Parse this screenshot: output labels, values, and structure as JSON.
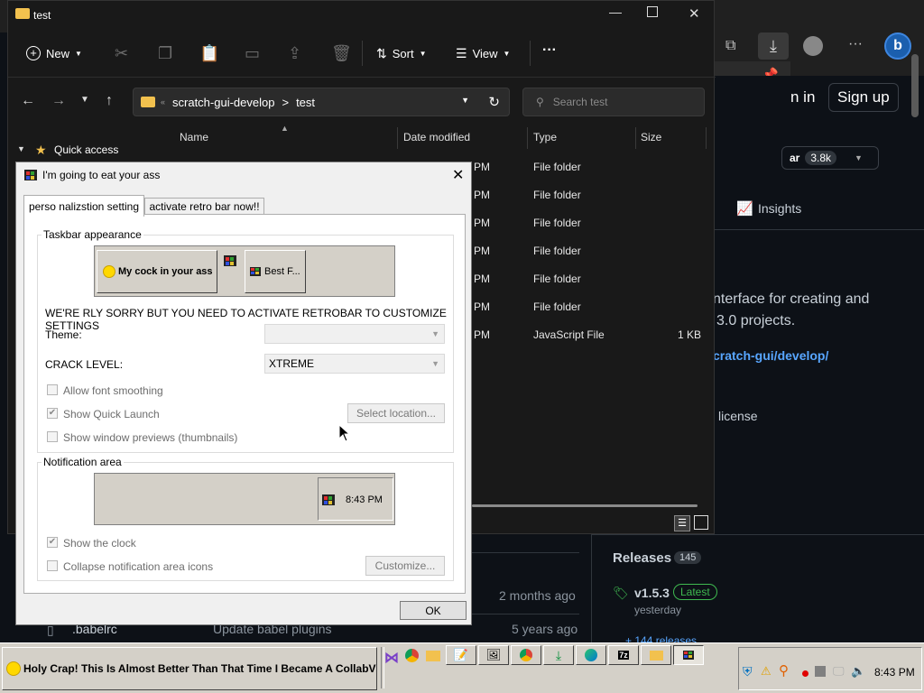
{
  "github": {
    "sign_in": "n in",
    "sign_up": "Sign up",
    "star_label": "ar",
    "star_count": "3.8k",
    "insights": "Insights",
    "description_1": "nterface for creating and",
    "description_2": "3.0 projects.",
    "link": "cratch-gui/develop/",
    "license": "license",
    "releases_label": "Releases",
    "releases_count": "145",
    "release_version": "v1.5.3",
    "release_badge": "Latest",
    "release_when": "yesterday",
    "more_releases": "+ 144 releases",
    "file_row_1_time": "2 months ago",
    "file_row_2_name": ".babelrc",
    "file_row_2_msg": "Update babel plugins",
    "file_row_2_time": "5 years ago"
  },
  "explorer": {
    "title": "test",
    "toolbar": {
      "new": "New",
      "sort": "Sort",
      "view": "View"
    },
    "breadcrumb": {
      "parent": "scratch-gui-develop",
      "sep": ">",
      "current": "test"
    },
    "search_placeholder": "Search test",
    "nav_quick_access": "Quick access",
    "columns": {
      "name": "Name",
      "date": "Date modified",
      "type": "Type",
      "size": "Size"
    },
    "rows": [
      {
        "date": "PM",
        "type": "File folder",
        "size": ""
      },
      {
        "date": "PM",
        "type": "File folder",
        "size": ""
      },
      {
        "date": "PM",
        "type": "File folder",
        "size": ""
      },
      {
        "date": "PM",
        "type": "File folder",
        "size": ""
      },
      {
        "date": "PM",
        "type": "File folder",
        "size": ""
      },
      {
        "date": "PM",
        "type": "File folder",
        "size": ""
      },
      {
        "date": "PM",
        "type": "JavaScript File",
        "size": "1 KB"
      }
    ]
  },
  "dialog": {
    "title": "I'm going to eat your ass",
    "tabs": [
      "perso nalizstion setting",
      "activate retro bar now!!"
    ],
    "taskbar_group": "Taskbar appearance",
    "preview_start": "My cock in your ass",
    "preview_task": "Best F...",
    "warning": "WE'RE RLY SORRY BUT YOU NEED TO ACTIVATE RETROBAR TO CUSTOMIZE SETTINGS",
    "theme_label": "Theme:",
    "theme_value": "",
    "crack_label": "CRACK LEVEL:",
    "crack_value": "XTREME",
    "font_smoothing": "Allow font smoothing",
    "quick_launch": "Show Quick Launch",
    "select_location": "Select location...",
    "window_previews": "Show window previews (thumbnails)",
    "notification_group": "Notification area",
    "preview_clock": "8:43 PM",
    "show_clock": "Show the clock",
    "collapse_icons": "Collapse notification area icons",
    "customize": "Customize...",
    "ok": "OK"
  },
  "taskbar": {
    "start_label": "Holy Crap! This Is Almost Better Than That Time I Became A CollabVM!",
    "clock": "8:43 PM"
  },
  "colors": {
    "accent": "#0078d4",
    "latest_green": "#3fb950",
    "link_blue": "#58a6ff"
  }
}
